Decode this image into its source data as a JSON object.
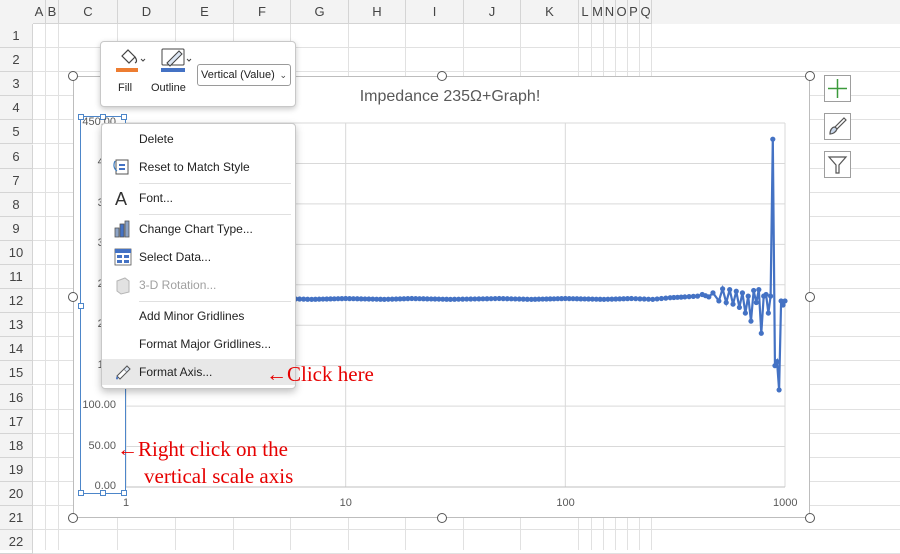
{
  "sheet": {
    "columns": [
      "A",
      "B",
      "C",
      "D",
      "E",
      "F",
      "G",
      "H",
      "I",
      "J",
      "K",
      "L",
      "M",
      "N",
      "O",
      "P",
      "Q"
    ],
    "rows": [
      "1",
      "2",
      "3",
      "4",
      "5",
      "6",
      "7",
      "8",
      "9",
      "10",
      "11",
      "12",
      "13",
      "14",
      "15",
      "16",
      "17",
      "18",
      "19",
      "20",
      "21",
      "22"
    ]
  },
  "chart": {
    "title": "Impedance 235Ω+Graph!",
    "selected_axis": "Vertical (Value)"
  },
  "chart_data": {
    "type": "scatter",
    "title": "Impedance 235Ω+Graph!",
    "xlabel": "",
    "ylabel": "",
    "x_scale": "log",
    "xlim": [
      1,
      1000
    ],
    "ylim": [
      0,
      450
    ],
    "y_ticks": [
      "0.00",
      "50.00",
      "100.00",
      "150",
      "200",
      "250",
      "300",
      "350",
      "400",
      "450.00"
    ],
    "x_ticks": [
      "1",
      "10",
      "100",
      "1000"
    ],
    "series": [
      {
        "color": "#4472c4",
        "x": [
          5,
          7,
          10,
          15,
          20,
          30,
          50,
          70,
          100,
          150,
          200,
          250,
          300,
          350,
          400,
          420,
          450,
          470,
          500,
          520,
          540,
          560,
          580,
          600,
          620,
          640,
          660,
          680,
          700,
          720,
          740,
          760,
          780,
          800,
          820,
          840,
          860,
          880,
          900,
          920,
          940,
          960,
          980,
          1000
        ],
        "y": [
          233,
          232,
          233,
          232,
          233,
          232,
          233,
          232,
          233,
          232,
          233,
          232,
          234,
          235,
          236,
          238,
          235,
          240,
          230,
          245,
          228,
          244,
          226,
          242,
          222,
          240,
          215,
          236,
          205,
          243,
          228,
          244,
          190,
          236,
          238,
          215,
          236,
          430,
          150,
          155,
          120,
          230,
          225,
          230
        ]
      }
    ]
  },
  "toolbar": {
    "fill_label": "Fill",
    "outline_label": "Outline",
    "axis_dropdown_value": "Vertical (Value)",
    "fill_color": "#ed7d31",
    "outline_color": "#4472c4"
  },
  "context_menu": {
    "items": [
      {
        "label": "Delete",
        "icon": "none",
        "enabled": true
      },
      {
        "label": "Reset to Match Style",
        "icon": "reset-style-icon",
        "enabled": true
      },
      {
        "label": "Font...",
        "icon": "font-icon",
        "enabled": true
      },
      {
        "label": "Change Chart Type...",
        "icon": "chart-type-icon",
        "enabled": true
      },
      {
        "label": "Select Data...",
        "icon": "select-data-icon",
        "enabled": true
      },
      {
        "label": "3-D Rotation...",
        "icon": "rotation-icon",
        "enabled": false
      },
      {
        "label": "Add Minor Gridlines",
        "icon": "none",
        "enabled": true
      },
      {
        "label": "Format Major Gridlines...",
        "icon": "none",
        "enabled": true
      },
      {
        "label": "Format Axis...",
        "icon": "format-axis-icon",
        "enabled": true
      }
    ]
  },
  "annotations": {
    "click_here": "←Click here",
    "right_click_line1": "←Right click on the",
    "right_click_line2": "vertical scale axis",
    "color": "#e60000"
  }
}
